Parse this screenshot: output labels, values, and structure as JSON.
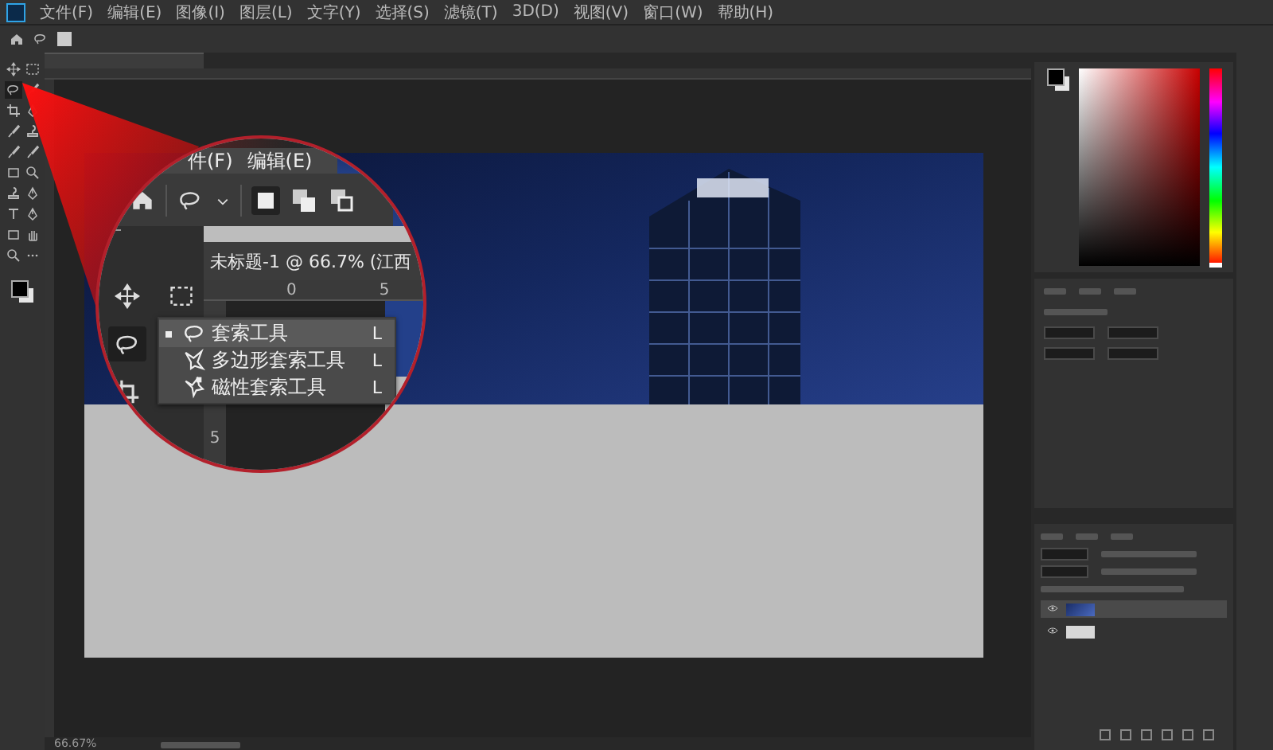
{
  "menu": [
    "文件(F)",
    "编辑(E)",
    "图像(I)",
    "图层(L)",
    "文字(Y)",
    "选择(S)",
    "滤镜(T)",
    "3D(D)",
    "视图(V)",
    "窗口(W)",
    "帮助(H)"
  ],
  "magnifier": {
    "menu": [
      "件(F)",
      "编辑(E)"
    ],
    "document_tab": "未标题-1 @ 66.7% (江西",
    "ruler_marks": [
      "0",
      "5"
    ],
    "vertical_ruler_mark": "5",
    "flyout": [
      {
        "label": "套索工具",
        "shortcut": "L",
        "selected": true
      },
      {
        "label": "多边形套索工具",
        "shortcut": "L",
        "selected": false
      },
      {
        "label": "磁性套索工具",
        "shortcut": "L",
        "selected": false
      }
    ]
  },
  "hue_slider": {
    "level": 0
  },
  "layers": [
    {
      "selected": true
    },
    {
      "selected": false
    }
  ],
  "status_bar": {
    "zoom": "66.67%"
  }
}
